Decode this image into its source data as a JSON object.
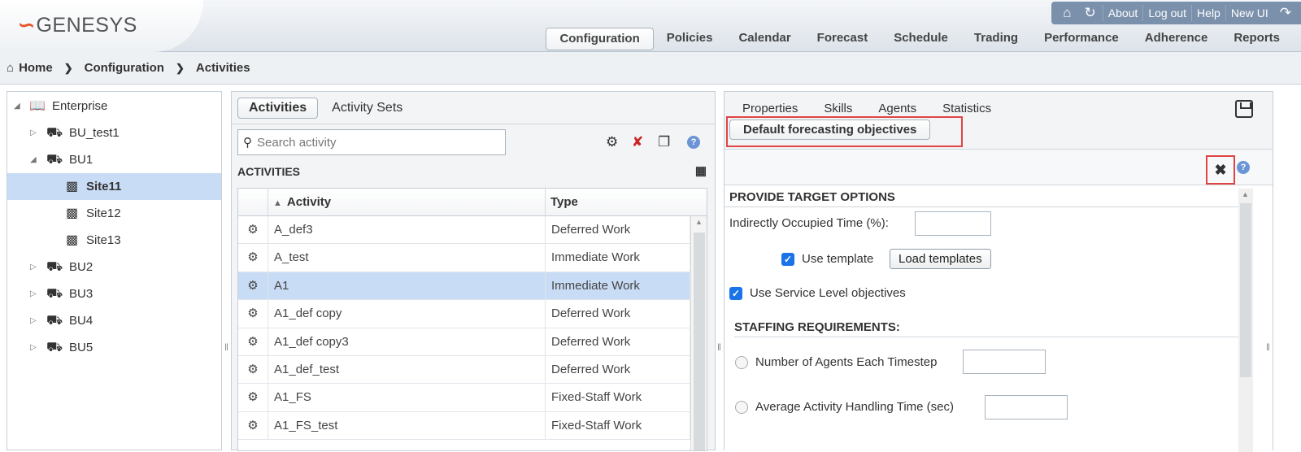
{
  "header": {
    "logo_mark": "ၜ",
    "logo_text": "GENESYS",
    "top_links": [
      "About",
      "Log out",
      "Help",
      "New UI"
    ],
    "nav": [
      "Configuration",
      "Policies",
      "Calendar",
      "Forecast",
      "Schedule",
      "Trading",
      "Performance",
      "Adherence",
      "Reports"
    ],
    "active_nav": "Configuration"
  },
  "breadcrumb": [
    "Home",
    "Configuration",
    "Activities"
  ],
  "tree": [
    {
      "label": "Enterprise",
      "level": 0,
      "expanded": true,
      "icon": "enterprise-icon"
    },
    {
      "label": "BU_test1",
      "level": 1,
      "expanded": false,
      "icon": "business-unit-icon"
    },
    {
      "label": "BU1",
      "level": 1,
      "expanded": true,
      "icon": "business-unit-icon"
    },
    {
      "label": "Site11",
      "level": 2,
      "selected": true,
      "icon": "site-icon"
    },
    {
      "label": "Site12",
      "level": 2,
      "icon": "site-icon"
    },
    {
      "label": "Site13",
      "level": 2,
      "icon": "site-icon"
    },
    {
      "label": "BU2",
      "level": 1,
      "expanded": false,
      "icon": "business-unit-icon"
    },
    {
      "label": "BU3",
      "level": 1,
      "expanded": false,
      "icon": "business-unit-icon"
    },
    {
      "label": "BU4",
      "level": 1,
      "expanded": false,
      "icon": "business-unit-icon"
    },
    {
      "label": "BU5",
      "level": 1,
      "expanded": false,
      "icon": "business-unit-icon"
    }
  ],
  "activities": {
    "tabs": [
      "Activities",
      "Activity Sets"
    ],
    "search_placeholder": "Search activity",
    "section_title": "ACTIVITIES",
    "columns": [
      "Activity",
      "Type"
    ],
    "rows": [
      {
        "name": "A_def3",
        "type": "Deferred Work"
      },
      {
        "name": "A_test",
        "type": "Immediate Work"
      },
      {
        "name": "A1",
        "type": "Immediate Work",
        "selected": true
      },
      {
        "name": "A1_def copy",
        "type": "Deferred Work"
      },
      {
        "name": "A1_def copy3",
        "type": "Deferred Work"
      },
      {
        "name": "A1_def_test",
        "type": "Deferred Work"
      },
      {
        "name": "A1_FS",
        "type": "Fixed-Staff Work"
      },
      {
        "name": "A1_FS_test",
        "type": "Fixed-Staff Work"
      }
    ]
  },
  "details": {
    "tabs": [
      "Properties",
      "Skills",
      "Agents",
      "Statistics"
    ],
    "active_subtab": "Default forecasting objectives",
    "section1": "PROVIDE TARGET OPTIONS",
    "ioc_label": "Indirectly Occupied Time (%):",
    "use_template_label": "Use template",
    "use_template_checked": true,
    "load_templates_label": "Load templates",
    "use_slo_label": "Use Service Level objectives",
    "use_slo_checked": true,
    "section2": "STAFFING REQUIREMENTS:",
    "radio1_label": "Number of Agents Each Timestep",
    "radio2_label": "Average Activity Handling Time (sec)"
  },
  "colors": {
    "highlight_red": "#e04444",
    "selection_blue": "#c9dcf5",
    "checkbox_blue": "#1a73e8",
    "brand_orange": "#e8542a"
  }
}
